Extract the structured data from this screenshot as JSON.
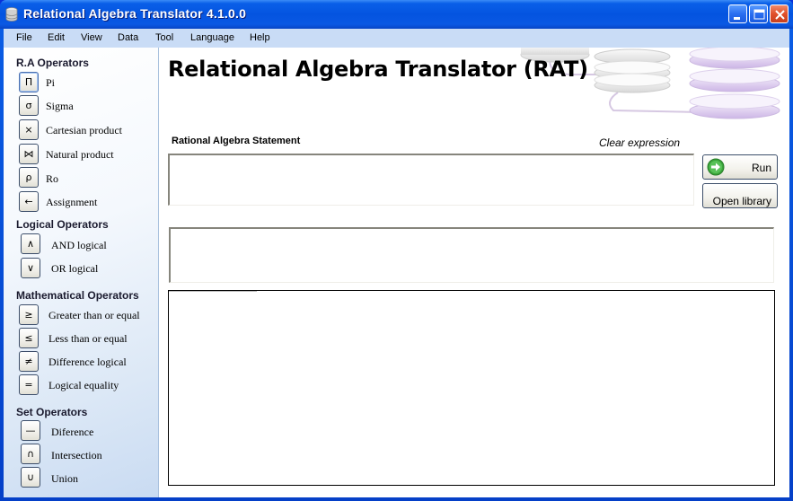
{
  "window": {
    "title": "Relational Algebra Translator 4.1.0.0",
    "controls": [
      "minimize",
      "maximize",
      "close"
    ]
  },
  "menu": [
    "File",
    "Edit",
    "View",
    "Data",
    "Tool",
    "Language",
    "Help"
  ],
  "sidebar": {
    "sections": [
      {
        "title": "R.A Operators",
        "items": [
          {
            "symbol": "Π",
            "label": "Pi",
            "icon": "pi-icon"
          },
          {
            "symbol": "σ",
            "label": "Sigma",
            "icon": "sigma-icon"
          },
          {
            "symbol": "×",
            "label": "Cartesian product",
            "icon": "times-icon"
          },
          {
            "symbol": "⋈",
            "label": "Natural product",
            "icon": "bowtie-icon"
          },
          {
            "symbol": "ρ",
            "label": "Ro",
            "icon": "rho-icon"
          },
          {
            "symbol": "←",
            "label": "Assignment",
            "icon": "left-arrow-icon"
          }
        ]
      },
      {
        "title": "Logical Operators",
        "items": [
          {
            "symbol": "∧",
            "label": "AND logical",
            "icon": "and-icon"
          },
          {
            "symbol": "∨",
            "label": "OR logical",
            "icon": "or-icon"
          }
        ]
      },
      {
        "title": "Mathematical Operators",
        "items": [
          {
            "symbol": "≥",
            "label": "Greater than or equal",
            "icon": "gte-icon"
          },
          {
            "symbol": "≤",
            "label": "Less than or equal",
            "icon": "lte-icon"
          },
          {
            "symbol": "≠",
            "label": "Difference logical",
            "icon": "neq-icon"
          },
          {
            "symbol": "=",
            "label": "Logical equality",
            "icon": "equals-icon"
          }
        ]
      },
      {
        "title": "Set Operators",
        "items": [
          {
            "symbol": "—",
            "label": "Diference",
            "icon": "minus-icon"
          },
          {
            "symbol": "∩",
            "label": "Intersection",
            "icon": "intersection-icon"
          },
          {
            "symbol": "∪",
            "label": "Union",
            "icon": "union-icon"
          }
        ]
      }
    ]
  },
  "main": {
    "heading": "Relational Algebra Translator (RAT)",
    "statement_label": "Rational Algebra Statement",
    "clear_expression": "Clear expression",
    "statement_value": "",
    "run_label": "Run",
    "open_library_label": "Open library",
    "output_value": ""
  },
  "colors": {
    "titlebar": "#0454e0",
    "menubar": "#c9dcf6",
    "run_icon": "#3aa53a",
    "close_button": "#e0502a"
  }
}
